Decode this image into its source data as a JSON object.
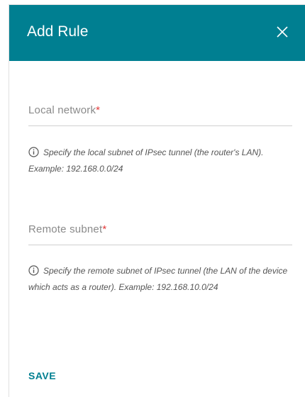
{
  "dialog": {
    "title": "Add Rule",
    "close_icon": "close-icon"
  },
  "fields": [
    {
      "label": "Local network",
      "required_mark": "*",
      "value": "",
      "hint": "Specify the local subnet of IPsec tunnel (the router's LAN). Example: 192.168.0.0/24"
    },
    {
      "label": "Remote subnet",
      "required_mark": "*",
      "value": "",
      "hint": "Specify the remote subnet of IPsec tunnel (the LAN of the device which acts as a router). Example: 192.168.10.0/24"
    }
  ],
  "actions": {
    "save_label": "SAVE"
  },
  "colors": {
    "accent": "#007f91",
    "required": "#e23a3a"
  },
  "icons": {
    "hint": "info-icon"
  }
}
